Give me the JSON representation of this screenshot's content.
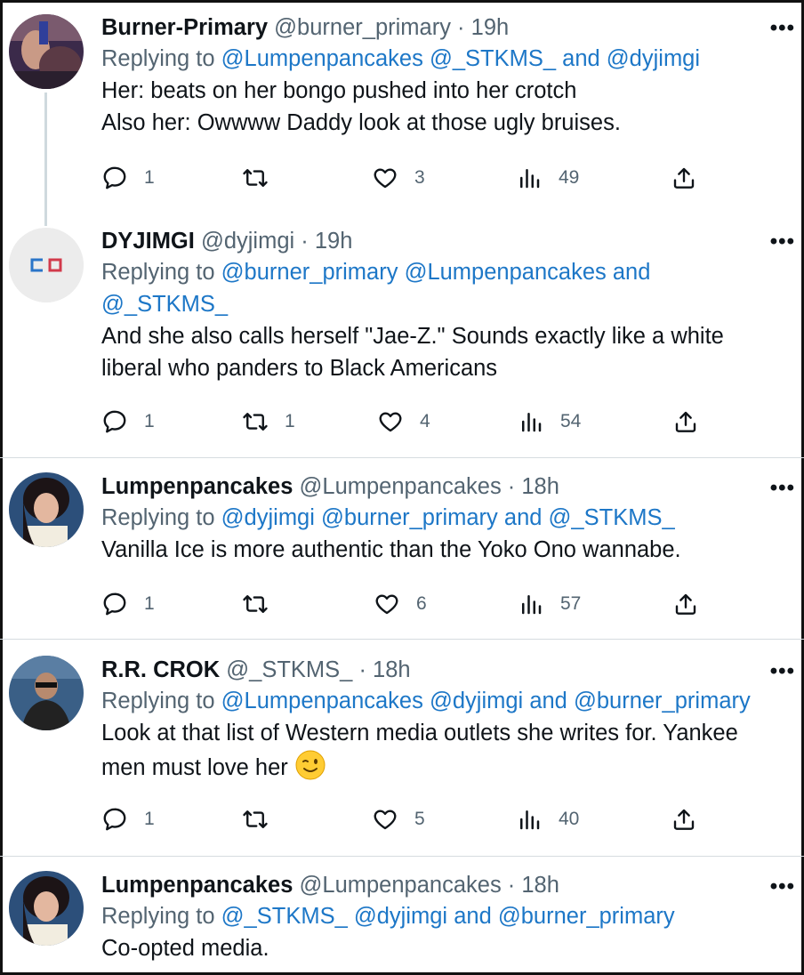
{
  "tweets": [
    {
      "name": "Burner-Primary",
      "handle": "@burner_primary",
      "time": "19h",
      "replying_prefix": "Replying to ",
      "mentions": [
        "@Lumpenpancakes",
        "@_STKMS_",
        "and",
        "@dyjimgi"
      ],
      "text_lines": [
        "Her:  beats on her bongo pushed into her crotch",
        "Also her: Owwww Daddy look at those ugly bruises."
      ],
      "replies": "1",
      "retweets": "",
      "likes": "3",
      "views": "49"
    },
    {
      "name": "DYJIMGI",
      "handle": "@dyjimgi",
      "time": "19h",
      "replying_prefix": "Replying to ",
      "mentions_line1": [
        "@burner_primary",
        "@Lumpenpancakes",
        "and"
      ],
      "mentions_line2": [
        "@_STKMS_"
      ],
      "text_lines": [
        "And she also calls herself \"Jae-Z.\" Sounds exactly like a white",
        "liberal who panders to Black Americans"
      ],
      "replies": "1",
      "retweets": "1",
      "likes": "4",
      "views": "54"
    },
    {
      "name": "Lumpenpancakes",
      "handle": "@Lumpenpancakes",
      "time": "18h",
      "replying_prefix": "Replying to ",
      "mentions": [
        "@dyjimgi",
        "@burner_primary",
        "and",
        "@_STKMS_"
      ],
      "text_lines": [
        "Vanilla Ice is more authentic than the Yoko Ono wannabe."
      ],
      "replies": "1",
      "retweets": "",
      "likes": "6",
      "views": "57"
    },
    {
      "name": "R.R. CROK",
      "handle": "@_STKMS_",
      "time": "18h",
      "replying_prefix": "Replying to ",
      "mentions": [
        "@Lumpenpancakes",
        "@dyjimgi",
        "and",
        "@burner_primary"
      ],
      "text_lines": [
        "Look at that list of Western media outlets she writes for. Yankee",
        "men must love her"
      ],
      "replies": "1",
      "retweets": "",
      "likes": "5",
      "views": "40"
    },
    {
      "name": "Lumpenpancakes",
      "handle": "@Lumpenpancakes",
      "time": "18h",
      "replying_prefix": "Replying to ",
      "mentions": [
        "@_STKMS_",
        "@dyjimgi",
        "and",
        "@burner_primary"
      ],
      "text_lines": [
        "Co-opted media."
      ]
    }
  ],
  "separator": " · ",
  "more_glyph": "•••",
  "colors": {
    "mention": "#1d77c7",
    "secondary": "#536471",
    "primary": "#0f1419",
    "thread_line": "#cfd9de"
  },
  "icons": [
    "reply-icon",
    "retweet-icon",
    "like-icon",
    "views-icon",
    "share-icon",
    "more-icon",
    "wink-emoji-icon"
  ]
}
